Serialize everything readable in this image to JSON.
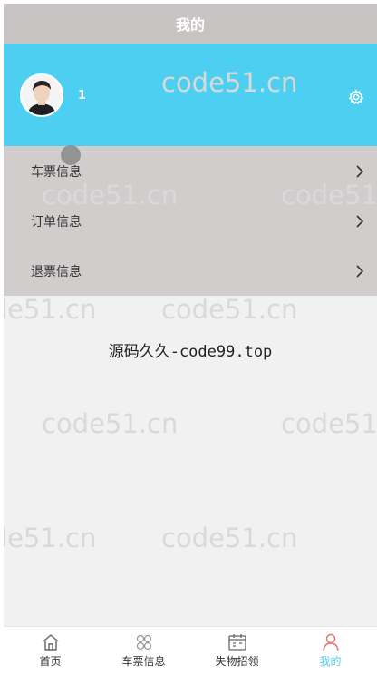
{
  "header": {
    "title": "我的"
  },
  "profile": {
    "username": "1"
  },
  "menu": {
    "items": [
      {
        "label": "车票信息"
      },
      {
        "label": "订单信息"
      },
      {
        "label": "退票信息"
      }
    ]
  },
  "brand_text": "源码久久-code99.top",
  "watermark": "code51.cn",
  "tabbar": {
    "items": [
      {
        "label": "首页",
        "icon": "home-icon"
      },
      {
        "label": "车票信息",
        "icon": "grid-icon"
      },
      {
        "label": "失物招领",
        "icon": "calendar-icon"
      },
      {
        "label": "我的",
        "icon": "user-icon",
        "active": true
      }
    ]
  },
  "colors": {
    "accent": "#4ccff0",
    "header_bg": "#c9c4c4",
    "menu_bg": "#d1cdcd",
    "page_bg": "#f1f1f1"
  }
}
